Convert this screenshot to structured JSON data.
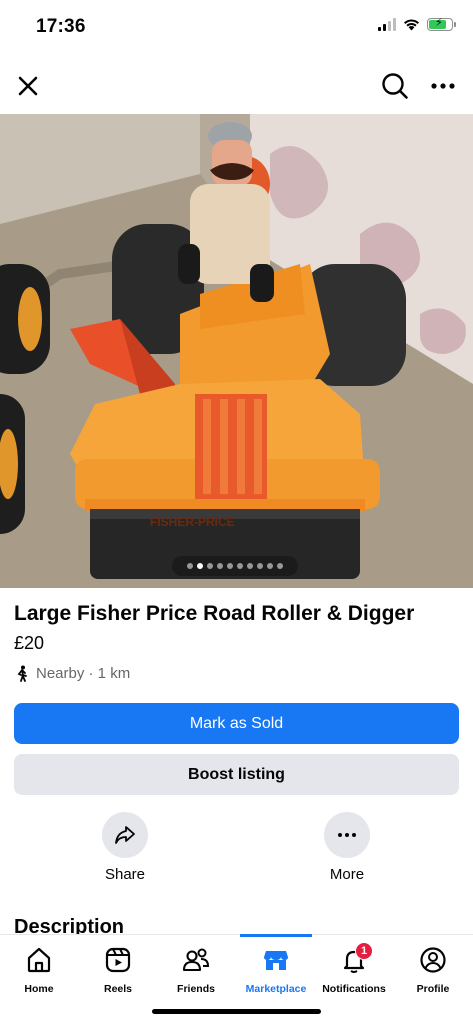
{
  "status_bar": {
    "time": "17:36"
  },
  "top_nav": {},
  "gallery": {
    "image_count": 10,
    "active_index": 1,
    "stamp_text": "FISHER-PRICE"
  },
  "listing": {
    "title": "Large Fisher Price Road Roller & Digger",
    "price": "£20",
    "location": "Nearby · 1 km"
  },
  "buttons": {
    "mark_sold": "Mark as Sold",
    "boost": "Boost listing"
  },
  "actions": {
    "share": "Share",
    "more": "More"
  },
  "description_heading": "Description",
  "tabs": [
    {
      "label": "Home",
      "icon": "home-icon"
    },
    {
      "label": "Reels",
      "icon": "reels-icon"
    },
    {
      "label": "Friends",
      "icon": "friends-icon"
    },
    {
      "label": "Marketplace",
      "icon": "marketplace-icon"
    },
    {
      "label": "Notifications",
      "icon": "bell-icon",
      "badge": "1"
    },
    {
      "label": "Profile",
      "icon": "profile-icon"
    }
  ],
  "active_tab": "Marketplace",
  "colors": {
    "accent": "#1877f2",
    "badge": "#e41e3f",
    "secondary_button": "#e4e6eb",
    "toy_orange": "#f29a2e"
  }
}
